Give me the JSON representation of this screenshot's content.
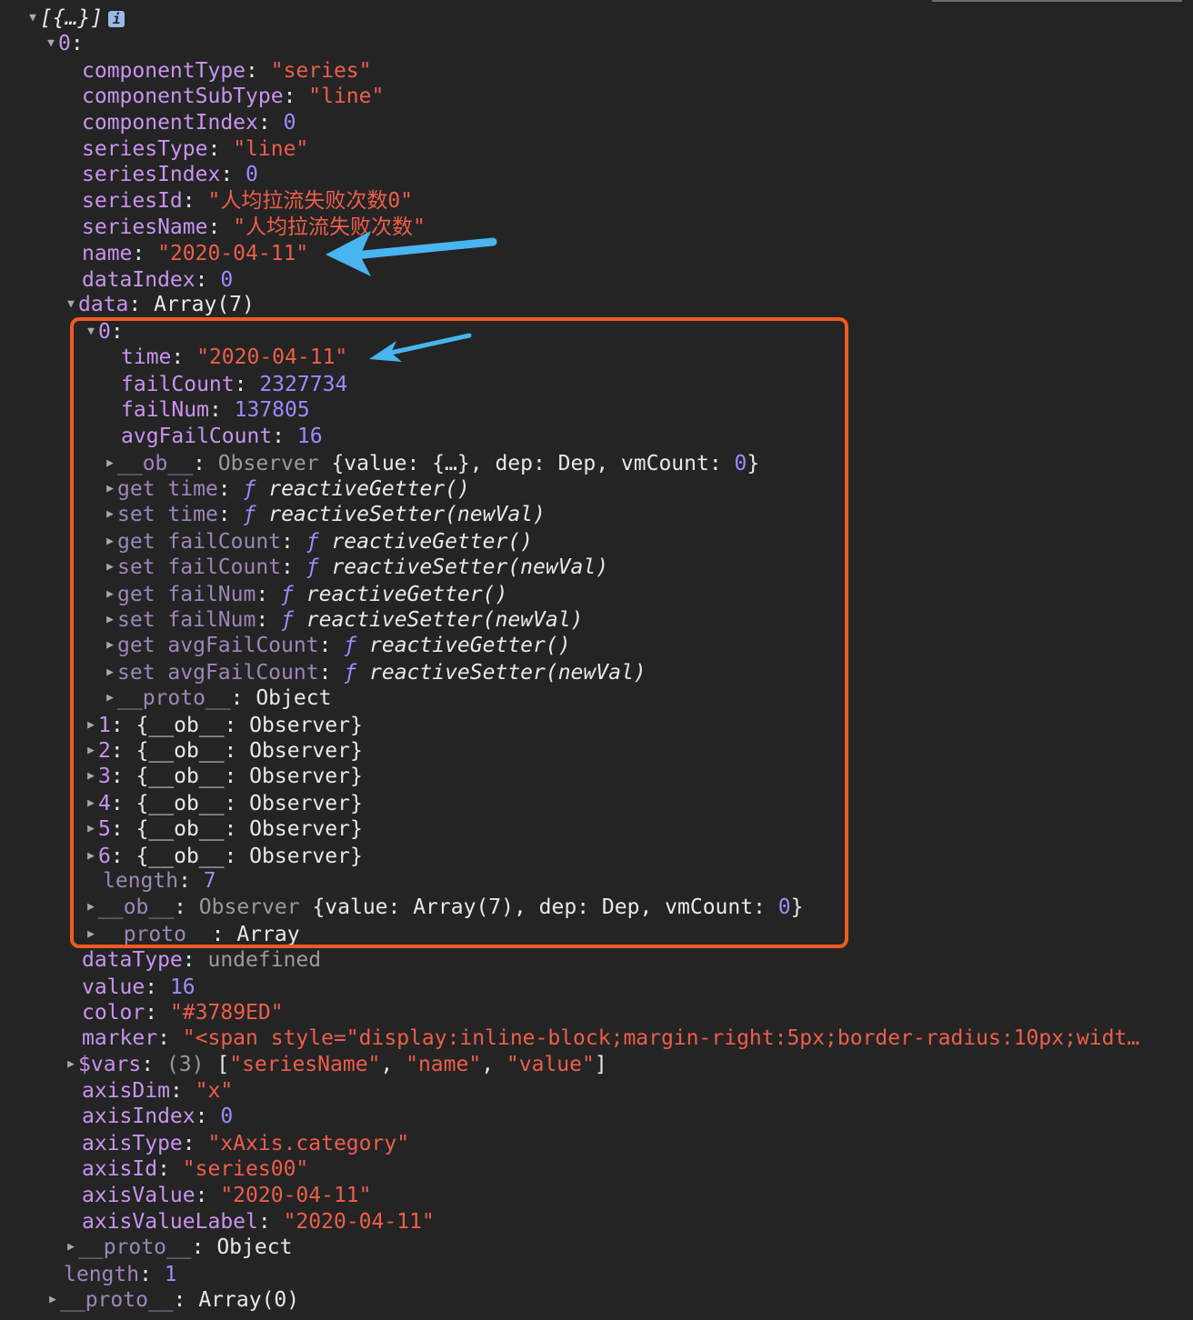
{
  "root": {
    "summary": "[{…}]",
    "info_badge": "i"
  },
  "item0": {
    "index": "0",
    "componentType": {
      "key": "componentType",
      "value": "\"series\""
    },
    "componentSubType": {
      "key": "componentSubType",
      "value": "\"line\""
    },
    "componentIndex": {
      "key": "componentIndex",
      "value": "0"
    },
    "seriesType": {
      "key": "seriesType",
      "value": "\"line\""
    },
    "seriesIndex": {
      "key": "seriesIndex",
      "value": "0"
    },
    "seriesId": {
      "key": "seriesId",
      "value": "\"人均拉流失败次数0\""
    },
    "seriesName": {
      "key": "seriesName",
      "value": "\"人均拉流失败次数\""
    },
    "name": {
      "key": "name",
      "value": "\"2020-04-11\""
    },
    "dataIndex": {
      "key": "dataIndex",
      "value": "0"
    },
    "data": {
      "key": "data",
      "summary": "Array(7)",
      "el0": {
        "index": "0",
        "time": {
          "key": "time",
          "value": "\"2020-04-11\""
        },
        "failCount": {
          "key": "failCount",
          "value": "2327734"
        },
        "failNum": {
          "key": "failNum",
          "value": "137805"
        },
        "avgFailCount": {
          "key": "avgFailCount",
          "value": "16"
        },
        "ob": {
          "key": "__ob__",
          "type": "Observer",
          "p1": "{value: {…}, dep: Dep, vmCount: ",
          "zero": "0",
          "p2": "}"
        },
        "accessors": [
          {
            "kind": "get",
            "name": "time",
            "f": "ƒ",
            "fn": "reactiveGetter()"
          },
          {
            "kind": "set",
            "name": "time",
            "f": "ƒ",
            "fn": "reactiveSetter(newVal)"
          },
          {
            "kind": "get",
            "name": "failCount",
            "f": "ƒ",
            "fn": "reactiveGetter()"
          },
          {
            "kind": "set",
            "name": "failCount",
            "f": "ƒ",
            "fn": "reactiveSetter(newVal)"
          },
          {
            "kind": "get",
            "name": "failNum",
            "f": "ƒ",
            "fn": "reactiveGetter()"
          },
          {
            "kind": "set",
            "name": "failNum",
            "f": "ƒ",
            "fn": "reactiveSetter(newVal)"
          },
          {
            "kind": "get",
            "name": "avgFailCount",
            "f": "ƒ",
            "fn": "reactiveGetter()"
          },
          {
            "kind": "set",
            "name": "avgFailCount",
            "f": "ƒ",
            "fn": "reactiveSetter(newVal)"
          }
        ],
        "proto": {
          "key": "__proto__",
          "value": "Object"
        }
      },
      "collapsed": [
        {
          "index": "1",
          "value": "{__ob__: Observer}"
        },
        {
          "index": "2",
          "value": "{__ob__: Observer}"
        },
        {
          "index": "3",
          "value": "{__ob__: Observer}"
        },
        {
          "index": "4",
          "value": "{__ob__: Observer}"
        },
        {
          "index": "5",
          "value": "{__ob__: Observer}"
        },
        {
          "index": "6",
          "value": "{__ob__: Observer}"
        }
      ],
      "length": {
        "key": "length",
        "value": "7"
      },
      "ob": {
        "key": "__ob__",
        "type": "Observer",
        "p1": "{value: Array(7), dep: Dep, vmCount: ",
        "zero": "0",
        "p2": "}"
      },
      "proto": {
        "key": "__proto__",
        "value": "Array"
      }
    },
    "dataType": {
      "key": "dataType",
      "value": "undefined"
    },
    "value": {
      "key": "value",
      "value": "16"
    },
    "color": {
      "key": "color",
      "value": "\"#3789ED\""
    },
    "marker": {
      "key": "marker",
      "value": "\"<span style=\"display:inline-block;margin-right:5px;border-radius:10px;widt…"
    },
    "vars": {
      "key": "$vars",
      "count": "(3)",
      "open": "[",
      "s1": "\"seriesName\"",
      "s2": "\"name\"",
      "s3": "\"value\"",
      "close": "]"
    },
    "axisDim": {
      "key": "axisDim",
      "value": "\"x\""
    },
    "axisIndex": {
      "key": "axisIndex",
      "value": "0"
    },
    "axisType": {
      "key": "axisType",
      "value": "\"xAxis.category\""
    },
    "axisId": {
      "key": "axisId",
      "value": "\"series00\""
    },
    "axisValue": {
      "key": "axisValue",
      "value": "\"2020-04-11\""
    },
    "axisValueLabel": {
      "key": "axisValueLabel",
      "value": "\"2020-04-11\""
    },
    "proto": {
      "key": "__proto__",
      "value": "Object"
    }
  },
  "rootLength": {
    "key": "length",
    "value": "1"
  },
  "rootProto": {
    "key": "__proto__",
    "value": "Array(0)"
  },
  "colors": {
    "background": "#242424",
    "key": "#c993f0",
    "string": "#ee5d4c",
    "number": "#9a8cff",
    "highlight": "#ef5a22",
    "arrow": "#48b4f0"
  }
}
